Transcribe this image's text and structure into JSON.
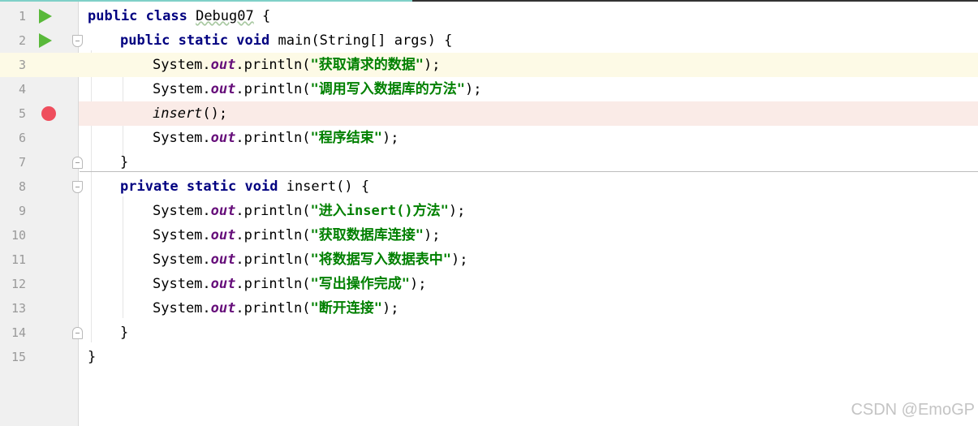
{
  "editor": {
    "lines": [
      {
        "n": "1",
        "parts": {
          "kw1": "public class",
          "t1": " ",
          "cls": "Debug07",
          "t2": " {"
        }
      },
      {
        "n": "2",
        "parts": {
          "kw1": "public static void",
          "t1": " main(String[] args) {"
        }
      },
      {
        "n": "3",
        "parts": {
          "t1": "System.",
          "out": "out",
          "t2": ".println(",
          "str": "\"获取请求的数据\"",
          "t3": ");"
        }
      },
      {
        "n": "4",
        "parts": {
          "t1": "System.",
          "out": "out",
          "t2": ".println(",
          "str": "\"调用写入数据库的方法\"",
          "t3": ");"
        }
      },
      {
        "n": "5",
        "parts": {
          "call": "insert",
          "t1": "();"
        }
      },
      {
        "n": "6",
        "parts": {
          "t1": "System.",
          "out": "out",
          "t2": ".println(",
          "str": "\"程序结束\"",
          "t3": ");"
        }
      },
      {
        "n": "7",
        "parts": {
          "t1": "}"
        }
      },
      {
        "n": "8",
        "parts": {
          "kw1": "private static void",
          "t1": " insert() {"
        }
      },
      {
        "n": "9",
        "parts": {
          "t1": "System.",
          "out": "out",
          "t2": ".println(",
          "str": "\"进入insert()方法\"",
          "t3": ");"
        }
      },
      {
        "n": "10",
        "parts": {
          "t1": "System.",
          "out": "out",
          "t2": ".println(",
          "str": "\"获取数据库连接\"",
          "t3": ");"
        }
      },
      {
        "n": "11",
        "parts": {
          "t1": "System.",
          "out": "out",
          "t2": ".println(",
          "str": "\"将数据写入数据表中\"",
          "t3": ");"
        }
      },
      {
        "n": "12",
        "parts": {
          "t1": "System.",
          "out": "out",
          "t2": ".println(",
          "str": "\"写出操作完成\"",
          "t3": ");"
        }
      },
      {
        "n": "13",
        "parts": {
          "t1": "System.",
          "out": "out",
          "t2": ".println(",
          "str": "\"断开连接\"",
          "t3": ");"
        }
      },
      {
        "n": "14",
        "parts": {
          "t1": "}"
        }
      },
      {
        "n": "15",
        "parts": {
          "t1": "}"
        }
      }
    ],
    "current_line": "3",
    "breakpoint_line": "5",
    "icons": {
      "run": "run-gutter-icon",
      "breakpoint": "breakpoint-icon",
      "fold": "fold-icon"
    },
    "colors": {
      "keyword": "#000080",
      "field": "#660e7a",
      "string": "#008000",
      "breakpoint": "#ef4e5d",
      "run": "#59b93a",
      "current_line_bg": "#fdfae6",
      "breakpoint_line_bg": "#faebe7"
    }
  },
  "watermark": "CSDN @EmoGP"
}
